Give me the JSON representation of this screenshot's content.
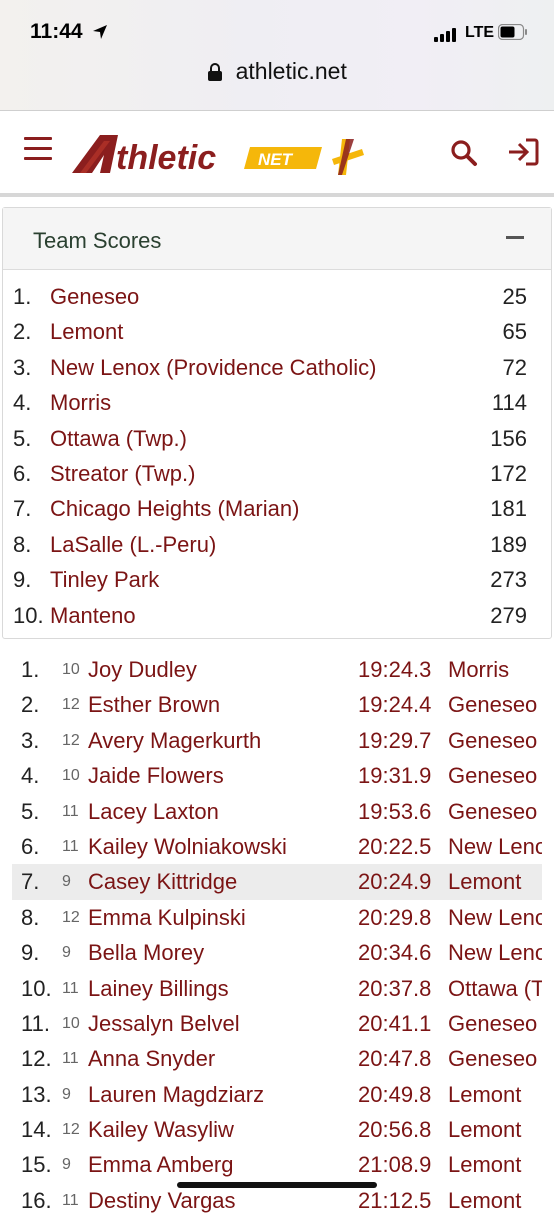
{
  "status_bar": {
    "time": "11:44",
    "network": "LTE",
    "url": "athletic.net"
  },
  "header": {
    "logo_text": "thletic",
    "logo_net": "NET",
    "menu_icon": "hamburger-icon",
    "search_icon": "search-icon",
    "login_icon": "login-icon",
    "colors": {
      "brand": "#8b1e1e",
      "gold": "#f5b70a"
    }
  },
  "team_scores": {
    "title": "Team Scores",
    "teams": [
      {
        "rank": "1.",
        "name": "Geneseo",
        "score": "25"
      },
      {
        "rank": "2.",
        "name": "Lemont",
        "score": "65"
      },
      {
        "rank": "3.",
        "name": "New Lenox (Providence Catholic)",
        "score": "72"
      },
      {
        "rank": "4.",
        "name": "Morris",
        "score": "114"
      },
      {
        "rank": "5.",
        "name": "Ottawa (Twp.)",
        "score": "156"
      },
      {
        "rank": "6.",
        "name": "Streator (Twp.)",
        "score": "172"
      },
      {
        "rank": "7.",
        "name": "Chicago Heights (Marian)",
        "score": "181"
      },
      {
        "rank": "8.",
        "name": "LaSalle (L.-Peru)",
        "score": "189"
      },
      {
        "rank": "9.",
        "name": "Tinley Park",
        "score": "273"
      },
      {
        "rank": "10.",
        "name": "Manteno",
        "score": "279"
      }
    ]
  },
  "results": [
    {
      "place": "1.",
      "grade": "10",
      "name": "Joy Dudley",
      "time": "19:24.3",
      "team": "Morris"
    },
    {
      "place": "2.",
      "grade": "12",
      "name": "Esther Brown",
      "time": "19:24.4",
      "team": "Geneseo"
    },
    {
      "place": "3.",
      "grade": "12",
      "name": "Avery Magerkurth",
      "time": "19:29.7",
      "team": "Geneseo"
    },
    {
      "place": "4.",
      "grade": "10",
      "name": "Jaide Flowers",
      "time": "19:31.9",
      "team": "Geneseo"
    },
    {
      "place": "5.",
      "grade": "11",
      "name": "Lacey Laxton",
      "time": "19:53.6",
      "team": "Geneseo"
    },
    {
      "place": "6.",
      "grade": "11",
      "name": "Kailey Wolniakowski",
      "time": "20:22.5",
      "team": "New Lenox"
    },
    {
      "place": "7.",
      "grade": "9",
      "name": "Casey Kittridge",
      "time": "20:24.9",
      "team": "Lemont"
    },
    {
      "place": "8.",
      "grade": "12",
      "name": "Emma Kulpinski",
      "time": "20:29.8",
      "team": "New Lenox"
    },
    {
      "place": "9.",
      "grade": "9",
      "name": "Bella Morey",
      "time": "20:34.6",
      "team": "New Lenox"
    },
    {
      "place": "10.",
      "grade": "11",
      "name": "Lainey Billings",
      "time": "20:37.8",
      "team": "Ottawa (Twp.)"
    },
    {
      "place": "11.",
      "grade": "10",
      "name": "Jessalyn Belvel",
      "time": "20:41.1",
      "team": "Geneseo"
    },
    {
      "place": "12.",
      "grade": "11",
      "name": "Anna Snyder",
      "time": "20:47.8",
      "team": "Geneseo"
    },
    {
      "place": "13.",
      "grade": "9",
      "name": "Lauren Magdziarz",
      "time": "20:49.8",
      "team": "Lemont"
    },
    {
      "place": "14.",
      "grade": "12",
      "name": "Kailey Wasyliw",
      "time": "20:56.8",
      "team": "Lemont"
    },
    {
      "place": "15.",
      "grade": "9",
      "name": "Emma Amberg",
      "time": "21:08.9",
      "team": "Lemont"
    },
    {
      "place": "16.",
      "grade": "11",
      "name": "Destiny Vargas",
      "time": "21:12.5",
      "team": "Lemont"
    }
  ],
  "highlighted_result_index": 6
}
